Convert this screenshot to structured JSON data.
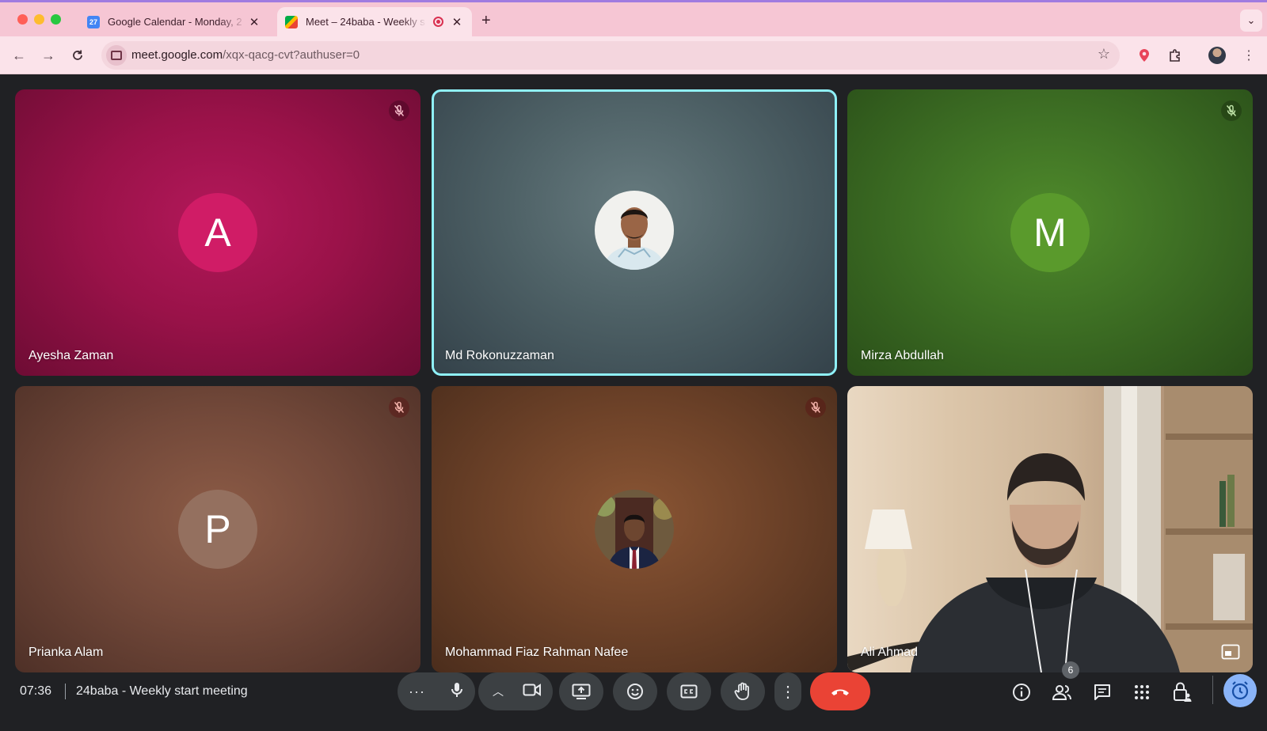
{
  "browser": {
    "tabs": [
      {
        "title": "Google Calendar - Monday, 2",
        "favicon": "calendar-icon",
        "favicon_text": "27"
      },
      {
        "title": "Meet – 24baba - Weekly s",
        "favicon": "meet-icon",
        "recording": true
      }
    ],
    "url_host": "meet.google.com",
    "url_path": "/xqx-qacg-cvt?authuser=0",
    "tabbar_color": "#f6c6d4",
    "toolbar_color": "#fbe3ea"
  },
  "meet": {
    "participants": [
      {
        "name": "Ayesha Zaman",
        "initial": "A",
        "avatar_color": "#d01c66",
        "muted": true
      },
      {
        "name": "Md Rokonuzzaman",
        "avatar": "photo",
        "speaking": true,
        "muted": false
      },
      {
        "name": "Mirza Abdullah",
        "initial": "M",
        "avatar_color": "#5a9a2c",
        "muted": true
      },
      {
        "name": "Prianka Alam",
        "initial": "P",
        "avatar_color": "#94705f",
        "muted": true
      },
      {
        "name": "Mohammad Fiaz Rahman Nafee",
        "avatar": "photo",
        "muted": true
      },
      {
        "name": "Ali Ahmad",
        "avatar": "video",
        "muted": false
      }
    ],
    "bottom_bar": {
      "time": "07:36",
      "meeting_title": "24baba - Weekly start meeting",
      "participant_count": "6",
      "hangup_color": "#ea4335",
      "active_accent": "#8ab4f8"
    }
  }
}
